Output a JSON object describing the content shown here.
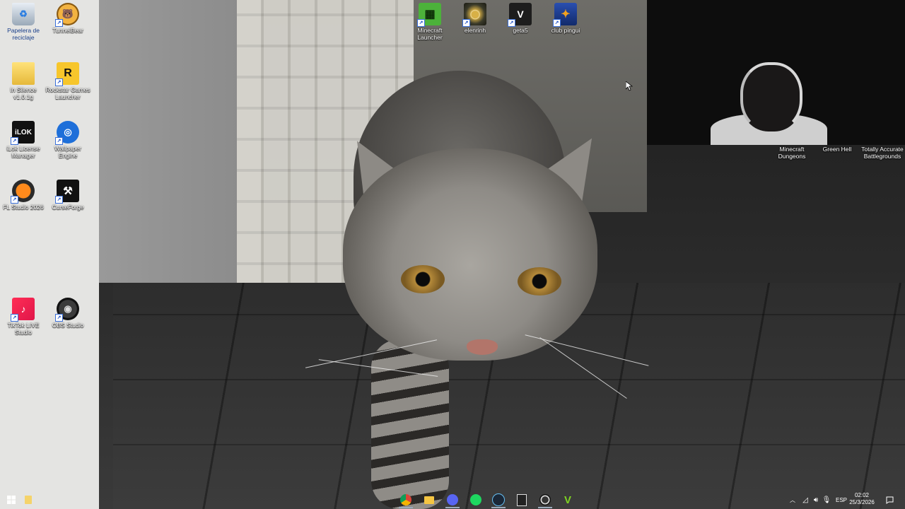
{
  "desktop_icons_left": [
    {
      "label": "Papelera de reciclaje",
      "icon": "recycle-bin-icon"
    },
    {
      "label": "TunnelBear",
      "icon": "tunnelbear-icon"
    },
    {
      "label": "In Silence v1.0.1g",
      "icon": "folder-icon"
    },
    {
      "label": "Rockstar Games Launcher",
      "icon": "rockstar-icon"
    },
    {
      "label": "iLok License Manager",
      "icon": "ilok-icon"
    },
    {
      "label": "Wallpaper Engine",
      "icon": "wallpaper-engine-icon"
    },
    {
      "label": "FL Studio 2026",
      "icon": "fl-studio-icon"
    },
    {
      "label": "CurseForge",
      "icon": "curseforge-icon"
    },
    {
      "label": "TikTok LIVE Studio",
      "icon": "tiktok-icon"
    },
    {
      "label": "OBS Studio",
      "icon": "obs-icon"
    }
  ],
  "desktop_icons_top": [
    {
      "label": "Minecraft Launcher",
      "icon": "minecraft-icon"
    },
    {
      "label": "elenrinh",
      "icon": "elden-ring-icon"
    },
    {
      "label": "geta5",
      "icon": "gta5-icon"
    },
    {
      "label": "club pingui",
      "icon": "counter-strike-icon"
    }
  ],
  "desktop_icons_right": [
    {
      "label": "Minecraft Dungeons"
    },
    {
      "label": "Green Hell"
    },
    {
      "label": "Totally Accurate Battlegrounds"
    }
  ],
  "taskbar": {
    "apps": [
      "chrome-icon",
      "file-explorer-icon",
      "discord-icon",
      "spotify-icon",
      "steam-icon",
      "epic-games-icon",
      "obs-icon",
      "vegas-icon"
    ],
    "tray_language": "ESP",
    "time": "02:02",
    "date": "25/3/2026"
  }
}
